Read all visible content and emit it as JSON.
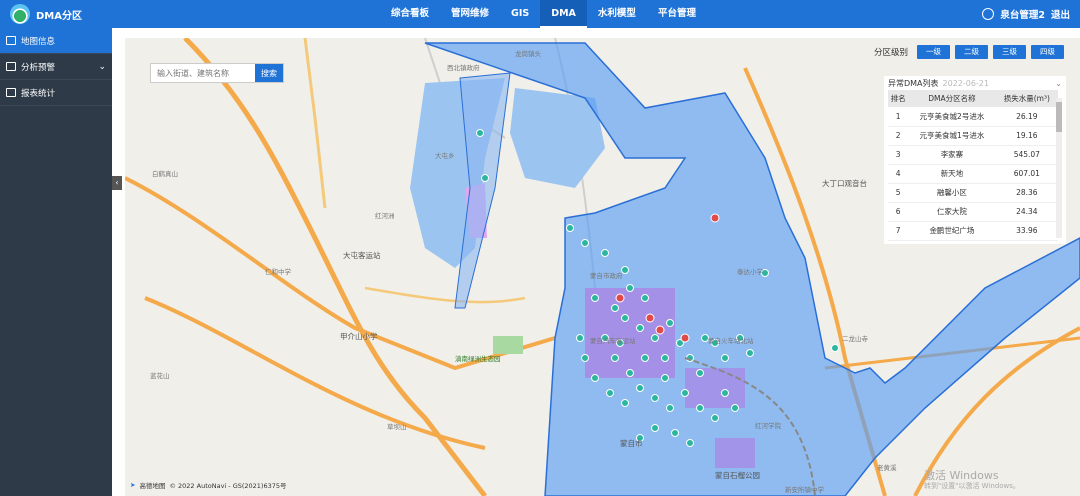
{
  "app": {
    "title": "DMA分区"
  },
  "nav": [
    "综合看板",
    "管网维修",
    "GIS",
    "DMA",
    "水利模型",
    "平台管理"
  ],
  "nav_active": "DMA",
  "user": {
    "name": "泉台管理2",
    "logout": "退出"
  },
  "sidebar": {
    "items": [
      {
        "label": "地图信息",
        "active": true
      },
      {
        "label": "分析预警",
        "active": false
      },
      {
        "label": "报表统计",
        "active": false
      }
    ]
  },
  "search": {
    "placeholder": "输入街道、建筑名称",
    "button": "搜索"
  },
  "levels": {
    "label": "分区级别",
    "buttons": [
      "一级",
      "二级",
      "三级",
      "四级"
    ]
  },
  "anomaly": {
    "title": "异常DMA列表",
    "date": "2022-06-21",
    "columns": [
      "排名",
      "DMA分区名称",
      "损失水量(m³)"
    ],
    "rows": [
      [
        "1",
        "元亨美食城2号进水",
        "26.19"
      ],
      [
        "2",
        "元亨美食城1号进水",
        "19.16"
      ],
      [
        "3",
        "李家寨",
        "545.07"
      ],
      [
        "4",
        "新天地",
        "607.01"
      ],
      [
        "5",
        "融馨小区",
        "28.36"
      ],
      [
        "6",
        "仁家大院",
        "24.34"
      ],
      [
        "7",
        "金鹏世纪广场",
        "33.96"
      ]
    ]
  },
  "map_labels": [
    "龙岗镇头",
    "西北镇政府",
    "大屯乡",
    "红河洲",
    "大屯客运站",
    "甲介山小学",
    "蒙自市政府",
    "蒙自石榴公园",
    "红河学院",
    "滇南绿洲生态园",
    "蒙自汽车客运站",
    "蒙自火车站北站",
    "泰达小学",
    "大丁口观音台",
    "二龙山寺",
    "老黄溪",
    "蓝花山",
    "草坝山",
    "白鹤真山",
    "新安所镇中学",
    "蒙自市",
    "仁和中学"
  ],
  "attribution": "© 2022 AutoNavi - GS(2021)6375号",
  "attribution_brand": "高德地图",
  "windows_notice": {
    "title": "激活 Windows",
    "sub": "转到\"设置\"以激活 Windows。"
  },
  "colors": {
    "primary": "#1f73d6",
    "sidebar": "#2e3a47",
    "dma_fill": "#5b9ef5",
    "marker": "#2bb6a0"
  },
  "icons": {
    "user": "user-icon",
    "map": "map-icon",
    "warning": "warning-icon",
    "report": "report-icon",
    "collapse": "collapse-arrow-icon"
  }
}
